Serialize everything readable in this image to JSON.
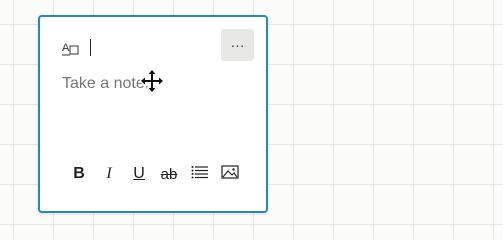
{
  "colors": {
    "background": "#fbfbfa",
    "grid": "#e6e6e4",
    "card_border": "#2a87b8",
    "placeholder": "#767676",
    "more_button_bg": "#e8e8e6"
  },
  "note": {
    "text_format_icon": "text-format-icon",
    "more_button_label": "···",
    "body_placeholder": "Take a note..."
  },
  "toolbar": {
    "bold_label": "B",
    "italic_label": "I",
    "underline_label": "U",
    "strikethrough_label": "ab",
    "list_icon": "bulleted-list-icon",
    "image_icon": "image-icon"
  },
  "cursor": {
    "icon": "move-cursor-icon"
  }
}
